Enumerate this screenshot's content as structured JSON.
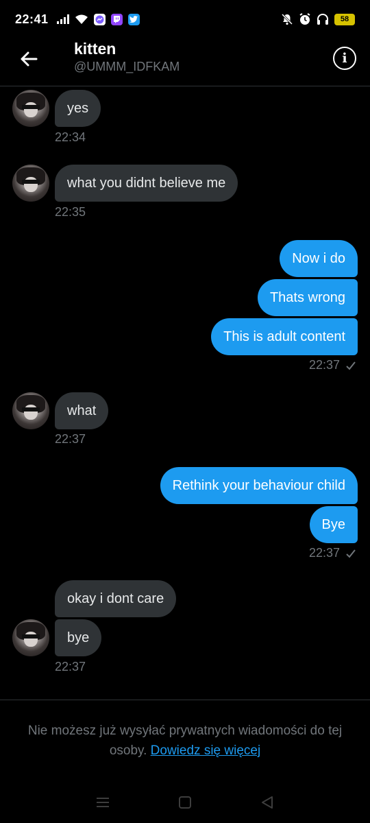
{
  "status_bar": {
    "time": "22:41",
    "battery": "58",
    "colors": {
      "messenger": "#7b5cff",
      "twitch": "#9146ff",
      "twitter": "#1d9bf0"
    }
  },
  "header": {
    "name": "kitten",
    "handle": "@UMMM_IDFKAM"
  },
  "messages": [
    {
      "text": "yes",
      "time": "22:34"
    },
    {
      "text": "what you didnt believe me",
      "time": "22:35"
    },
    {
      "text": "Now i do"
    },
    {
      "text": "Thats wrong"
    },
    {
      "text": "This is adult content",
      "time": "22:37"
    },
    {
      "text": "what",
      "time": "22:37"
    },
    {
      "text": "Rethink your behaviour child"
    },
    {
      "text": "Bye",
      "time": "22:37"
    },
    {
      "text": "okay i dont care"
    },
    {
      "text": "bye",
      "time": "22:37"
    }
  ],
  "footer": {
    "notice": "Nie możesz już wysyłać prywatnych wiadomości do tej osoby.",
    "link": "Dowiedz się więcej"
  },
  "colors": {
    "accent": "#1d9bf0",
    "incoming_bubble": "#2f3336",
    "background": "#000000",
    "muted_text": "#71767b"
  }
}
